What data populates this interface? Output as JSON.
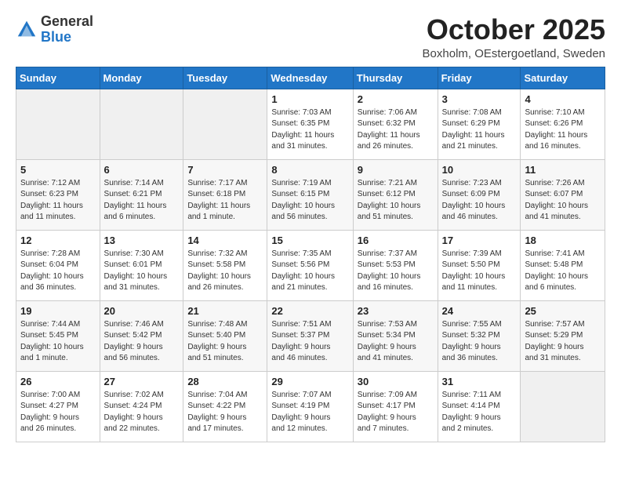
{
  "logo": {
    "general": "General",
    "blue": "Blue"
  },
  "title": "October 2025",
  "location": "Boxholm, OEstergoetland, Sweden",
  "days_of_week": [
    "Sunday",
    "Monday",
    "Tuesday",
    "Wednesday",
    "Thursday",
    "Friday",
    "Saturday"
  ],
  "weeks": [
    [
      {
        "day": "",
        "info": ""
      },
      {
        "day": "",
        "info": ""
      },
      {
        "day": "",
        "info": ""
      },
      {
        "day": "1",
        "info": "Sunrise: 7:03 AM\nSunset: 6:35 PM\nDaylight: 11 hours\nand 31 minutes."
      },
      {
        "day": "2",
        "info": "Sunrise: 7:06 AM\nSunset: 6:32 PM\nDaylight: 11 hours\nand 26 minutes."
      },
      {
        "day": "3",
        "info": "Sunrise: 7:08 AM\nSunset: 6:29 PM\nDaylight: 11 hours\nand 21 minutes."
      },
      {
        "day": "4",
        "info": "Sunrise: 7:10 AM\nSunset: 6:26 PM\nDaylight: 11 hours\nand 16 minutes."
      }
    ],
    [
      {
        "day": "5",
        "info": "Sunrise: 7:12 AM\nSunset: 6:23 PM\nDaylight: 11 hours\nand 11 minutes."
      },
      {
        "day": "6",
        "info": "Sunrise: 7:14 AM\nSunset: 6:21 PM\nDaylight: 11 hours\nand 6 minutes."
      },
      {
        "day": "7",
        "info": "Sunrise: 7:17 AM\nSunset: 6:18 PM\nDaylight: 11 hours\nand 1 minute."
      },
      {
        "day": "8",
        "info": "Sunrise: 7:19 AM\nSunset: 6:15 PM\nDaylight: 10 hours\nand 56 minutes."
      },
      {
        "day": "9",
        "info": "Sunrise: 7:21 AM\nSunset: 6:12 PM\nDaylight: 10 hours\nand 51 minutes."
      },
      {
        "day": "10",
        "info": "Sunrise: 7:23 AM\nSunset: 6:09 PM\nDaylight: 10 hours\nand 46 minutes."
      },
      {
        "day": "11",
        "info": "Sunrise: 7:26 AM\nSunset: 6:07 PM\nDaylight: 10 hours\nand 41 minutes."
      }
    ],
    [
      {
        "day": "12",
        "info": "Sunrise: 7:28 AM\nSunset: 6:04 PM\nDaylight: 10 hours\nand 36 minutes."
      },
      {
        "day": "13",
        "info": "Sunrise: 7:30 AM\nSunset: 6:01 PM\nDaylight: 10 hours\nand 31 minutes."
      },
      {
        "day": "14",
        "info": "Sunrise: 7:32 AM\nSunset: 5:58 PM\nDaylight: 10 hours\nand 26 minutes."
      },
      {
        "day": "15",
        "info": "Sunrise: 7:35 AM\nSunset: 5:56 PM\nDaylight: 10 hours\nand 21 minutes."
      },
      {
        "day": "16",
        "info": "Sunrise: 7:37 AM\nSunset: 5:53 PM\nDaylight: 10 hours\nand 16 minutes."
      },
      {
        "day": "17",
        "info": "Sunrise: 7:39 AM\nSunset: 5:50 PM\nDaylight: 10 hours\nand 11 minutes."
      },
      {
        "day": "18",
        "info": "Sunrise: 7:41 AM\nSunset: 5:48 PM\nDaylight: 10 hours\nand 6 minutes."
      }
    ],
    [
      {
        "day": "19",
        "info": "Sunrise: 7:44 AM\nSunset: 5:45 PM\nDaylight: 10 hours\nand 1 minute."
      },
      {
        "day": "20",
        "info": "Sunrise: 7:46 AM\nSunset: 5:42 PM\nDaylight: 9 hours\nand 56 minutes."
      },
      {
        "day": "21",
        "info": "Sunrise: 7:48 AM\nSunset: 5:40 PM\nDaylight: 9 hours\nand 51 minutes."
      },
      {
        "day": "22",
        "info": "Sunrise: 7:51 AM\nSunset: 5:37 PM\nDaylight: 9 hours\nand 46 minutes."
      },
      {
        "day": "23",
        "info": "Sunrise: 7:53 AM\nSunset: 5:34 PM\nDaylight: 9 hours\nand 41 minutes."
      },
      {
        "day": "24",
        "info": "Sunrise: 7:55 AM\nSunset: 5:32 PM\nDaylight: 9 hours\nand 36 minutes."
      },
      {
        "day": "25",
        "info": "Sunrise: 7:57 AM\nSunset: 5:29 PM\nDaylight: 9 hours\nand 31 minutes."
      }
    ],
    [
      {
        "day": "26",
        "info": "Sunrise: 7:00 AM\nSunset: 4:27 PM\nDaylight: 9 hours\nand 26 minutes."
      },
      {
        "day": "27",
        "info": "Sunrise: 7:02 AM\nSunset: 4:24 PM\nDaylight: 9 hours\nand 22 minutes."
      },
      {
        "day": "28",
        "info": "Sunrise: 7:04 AM\nSunset: 4:22 PM\nDaylight: 9 hours\nand 17 minutes."
      },
      {
        "day": "29",
        "info": "Sunrise: 7:07 AM\nSunset: 4:19 PM\nDaylight: 9 hours\nand 12 minutes."
      },
      {
        "day": "30",
        "info": "Sunrise: 7:09 AM\nSunset: 4:17 PM\nDaylight: 9 hours\nand 7 minutes."
      },
      {
        "day": "31",
        "info": "Sunrise: 7:11 AM\nSunset: 4:14 PM\nDaylight: 9 hours\nand 2 minutes."
      },
      {
        "day": "",
        "info": ""
      }
    ]
  ]
}
